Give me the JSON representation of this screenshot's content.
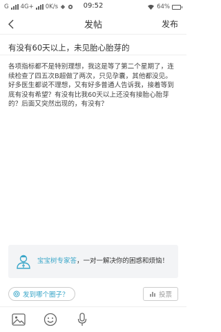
{
  "status_bar": {
    "carrier": "G",
    "network": "4G+",
    "speed": "0K/s",
    "time": "09:52",
    "battery": "64%",
    "battery_level": 0.64
  },
  "nav": {
    "title": "发帖",
    "publish_label": "发布"
  },
  "post": {
    "title": "有没有60天以上，未见胎心胎芽的",
    "body": "各项指标都不是特别理想，我这是等了第二个星期了，连续检查了四五次B超做了两次，只见孕囊，其他都没见。好多医生都说不理想，又有好多普通人告诉我，接着等到底有没有希望？有没有比我60天以上还没有接胎心胎芽的？后面又突然出现的，有没有？"
  },
  "expert": {
    "link_text": "宝宝树专家答",
    "description": "，一对一解决你的困惑和烦恼！"
  },
  "actions": {
    "circle_label": "发到哪个圈子？",
    "vote_label": "投票"
  },
  "toolbar": {
    "icons": [
      "image-icon",
      "emoji-icon",
      "microphone-icon"
    ]
  },
  "colors": {
    "accent": "#3aa6c8",
    "text": "#333333",
    "card_bg": "#f3f4f6"
  }
}
